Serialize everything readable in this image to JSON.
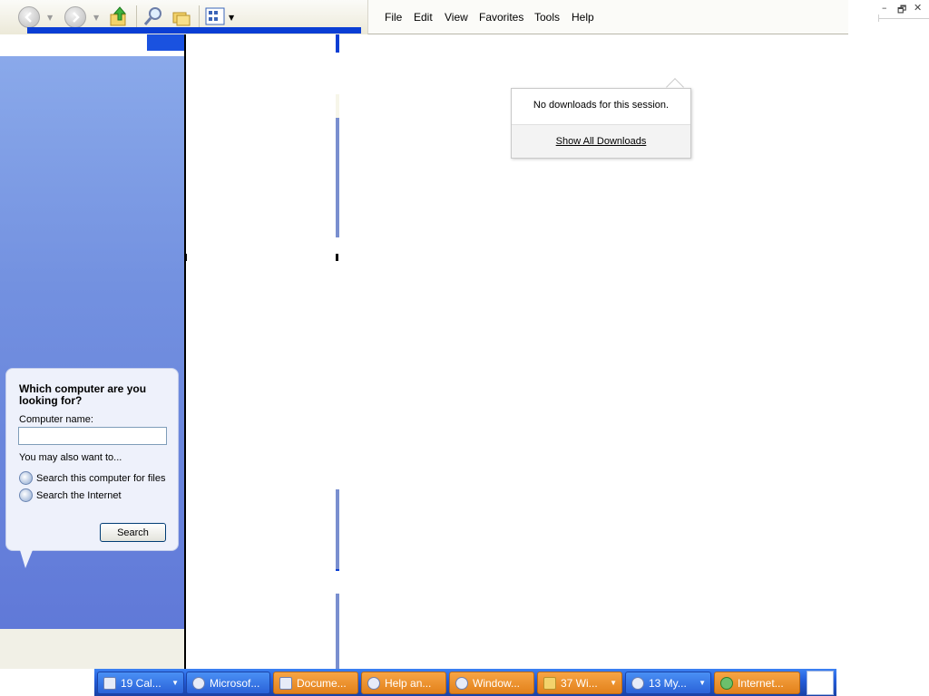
{
  "toolbar": {
    "back_label": "Back",
    "forward_label": "Forward",
    "icons": [
      "back-arrow-icon",
      "forward-arrow-icon",
      "up-folder-icon",
      "search-magnifier-icon",
      "folders-icon",
      "views-grid-icon"
    ]
  },
  "menubar": {
    "items": [
      "File",
      "Edit",
      "View",
      "Favorites",
      "Tools",
      "Help"
    ]
  },
  "window_controls": {
    "minimize": "–",
    "restore": "🗗",
    "close": "✕"
  },
  "search_assistant": {
    "title": "Which computer are you looking for?",
    "computer_name_label": "Computer name:",
    "computer_name_value": "",
    "also_label": "You may also want to...",
    "link_search_computer": "Search this computer for files",
    "link_search_internet": "Search the Internet",
    "search_button": "Search"
  },
  "downloads_popup": {
    "message": "No downloads for this session.",
    "show_all": "Show All Downloads"
  },
  "taskbar": {
    "buttons": [
      {
        "label": "19 Cal...",
        "style": "blue"
      },
      {
        "label": "Microsof...",
        "style": "blue"
      },
      {
        "label": "Docume...",
        "style": "orange"
      },
      {
        "label": "Help an...",
        "style": "orange"
      },
      {
        "label": "Window...",
        "style": "orange"
      },
      {
        "label": "37 Wi...",
        "style": "orange"
      },
      {
        "label": "13 My...",
        "style": "blue"
      },
      {
        "label": "Internet...",
        "style": "orange"
      }
    ]
  },
  "colors": {
    "pane_blue": "#7391e0",
    "taskbar_blue": "#245edb",
    "taskbar_orange": "#e2811b",
    "loading_blue": "#0a3ed4"
  }
}
